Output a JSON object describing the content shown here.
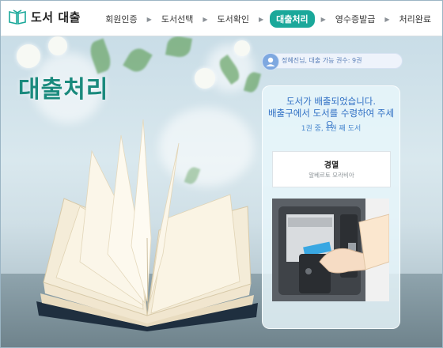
{
  "header": {
    "app_title": "도서 대출",
    "steps": [
      {
        "label": "회원인증",
        "active": false
      },
      {
        "label": "도서선택",
        "active": false
      },
      {
        "label": "도서확인",
        "active": false
      },
      {
        "label": "대출처리",
        "active": true
      },
      {
        "label": "영수증발급",
        "active": false
      },
      {
        "label": "처리완료",
        "active": false
      }
    ],
    "separator": "▶"
  },
  "hero": {
    "title": "대출처리"
  },
  "user": {
    "info": "정혜진님, 대출 가능 권수: 9권"
  },
  "panel": {
    "message_line1": "도서가 배출되었습니다.",
    "message_line2": "배출구에서 도서를 수령하여 주세요.",
    "count_text": "1권 중, 1권 째 도서",
    "book": {
      "title": "경멸",
      "author": "알베르토 모라비아"
    }
  },
  "colors": {
    "accent": "#1aa89a",
    "title_green": "#1a8a7d",
    "message_blue": "#2f6fc4"
  }
}
